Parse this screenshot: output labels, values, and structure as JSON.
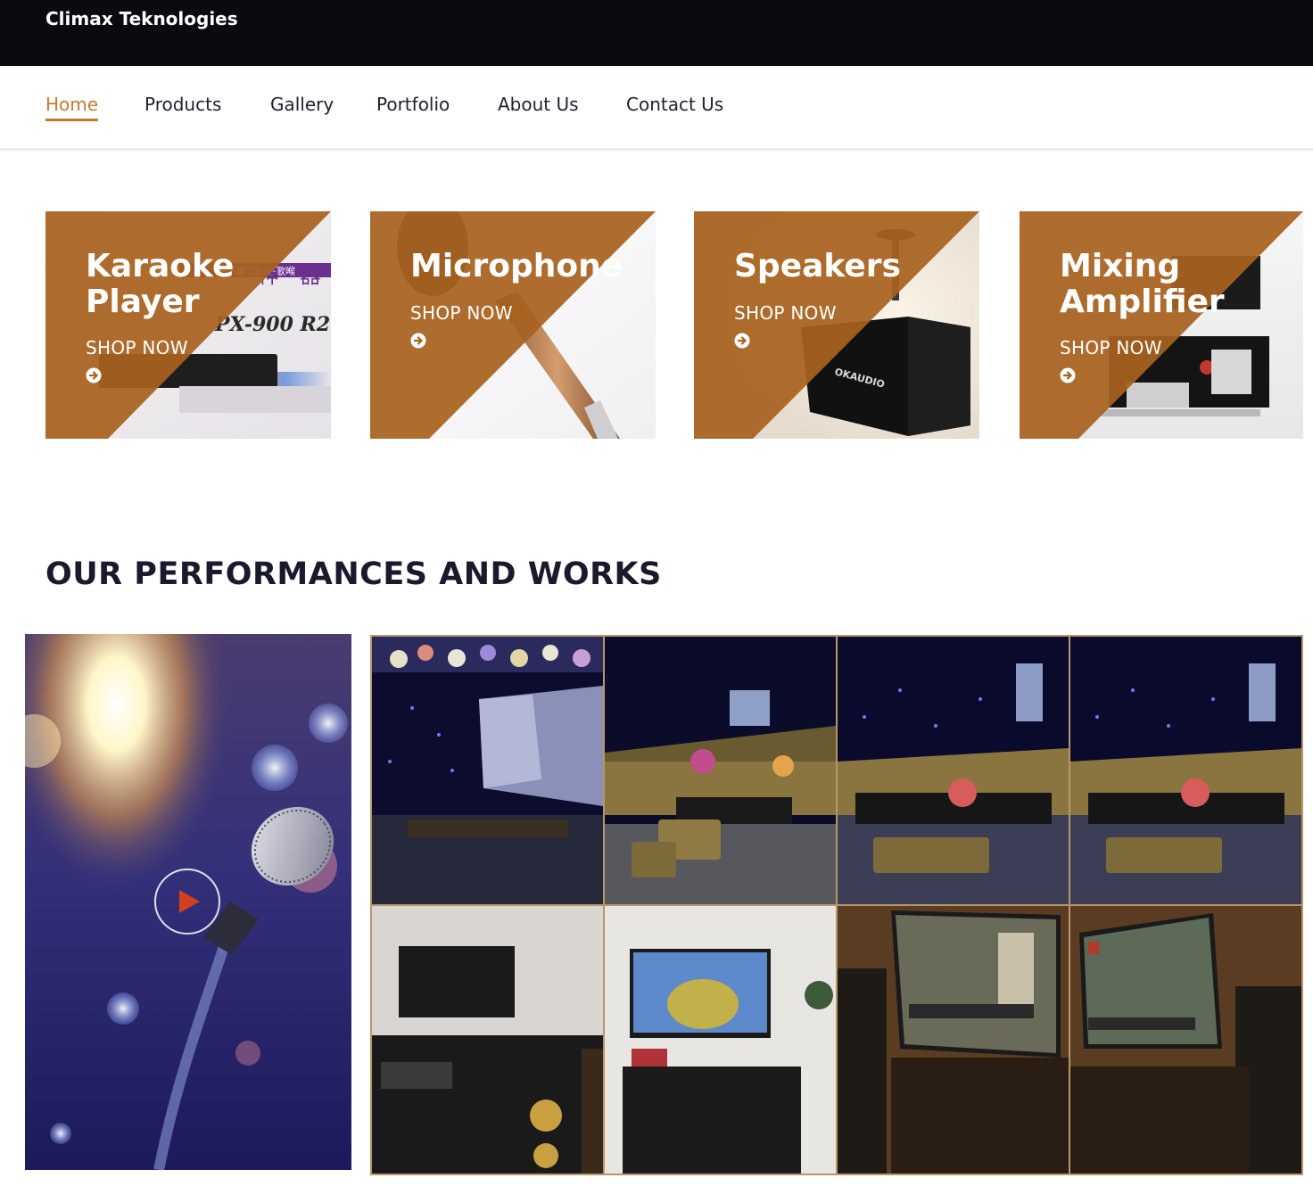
{
  "header": {
    "brand": "Climax Teknologies"
  },
  "nav": {
    "items": [
      {
        "label": "Home",
        "active": true
      },
      {
        "label": "Products",
        "active": false
      },
      {
        "label": "Gallery",
        "active": false
      },
      {
        "label": "Portfolio",
        "active": false
      },
      {
        "label": "About Us",
        "active": false
      },
      {
        "label": "Contact Us",
        "active": false
      }
    ]
  },
  "products": [
    {
      "title_line1": "Karaoke",
      "title_line2": "Player",
      "shop_label": "SHOP NOW",
      "image_text": "PX-900 R2"
    },
    {
      "title_line1": "Microphone",
      "title_line2": "",
      "shop_label": "SHOP NOW"
    },
    {
      "title_line1": "Speakers",
      "title_line2": "",
      "shop_label": "SHOP NOW",
      "image_text": "OKAUDIO"
    },
    {
      "title_line1": "Mixing",
      "title_line2": "Amplifier",
      "shop_label": "SHOP NOW"
    }
  ],
  "works": {
    "title": "OUR PERFORMANCES AND WORKS"
  },
  "colors": {
    "accent": "#c47a31",
    "overlay": "#a8621f",
    "topbar": "#0b0a10",
    "gallery_border": "#b79668"
  },
  "icons": {
    "shop_arrow": "circle-arrow-right-icon",
    "play": "play-icon"
  }
}
